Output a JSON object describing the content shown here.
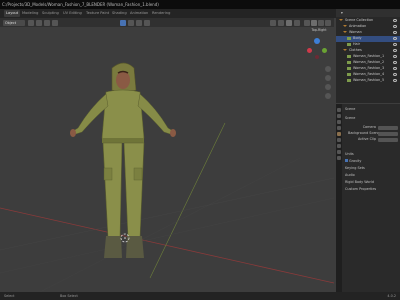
{
  "window_title": "C:/Projects/3D_Models/Woman_Fashion_7_BLENDER (Woman_Fashion_1.blend)",
  "workspace_tabs": [
    "Layout",
    "Modeling",
    "Sculpting",
    "UV Editing",
    "Texture Paint",
    "Shading",
    "Animation",
    "Rendering"
  ],
  "viewport": {
    "object_mode": "Object",
    "gizmo_label": "Top-Right",
    "axis_labels": {
      "x": "X",
      "y": "Y",
      "z": "Z"
    }
  },
  "outliner": {
    "title": "Scene",
    "items": [
      {
        "label": "Scene Collection",
        "indent": 0,
        "type": "collection"
      },
      {
        "label": "Animation",
        "indent": 1,
        "type": "collection"
      },
      {
        "label": "Woman",
        "indent": 1,
        "type": "collection"
      },
      {
        "label": "Body",
        "indent": 2,
        "type": "object",
        "selected": true
      },
      {
        "label": "Hair",
        "indent": 2,
        "type": "object"
      },
      {
        "label": "Clothes",
        "indent": 1,
        "type": "collection"
      },
      {
        "label": "Woman_Fashion_1",
        "indent": 2,
        "type": "object"
      },
      {
        "label": "Woman_Fashion_2",
        "indent": 2,
        "type": "object"
      },
      {
        "label": "Woman_Fashion_3",
        "indent": 2,
        "type": "object"
      },
      {
        "label": "Woman_Fashion_4",
        "indent": 2,
        "type": "object"
      },
      {
        "label": "Woman_Fashion_5",
        "indent": 2,
        "type": "object"
      }
    ]
  },
  "properties": {
    "title": "Scene",
    "section": "Scene",
    "fields": [
      {
        "label": "Camera"
      },
      {
        "label": "Background Scene"
      },
      {
        "label": "Active Clip"
      }
    ],
    "panels": [
      "Units",
      "Gravity",
      "Keying Sets",
      "Audio",
      "Rigid Body World",
      "Custom Properties"
    ]
  },
  "statusbar": {
    "left": "Select",
    "center": "Box Select",
    "right": "4.0.2"
  },
  "colors": {
    "accent": "#4772b3",
    "selection": "#334d80",
    "collection_icon": "#b07a30"
  }
}
